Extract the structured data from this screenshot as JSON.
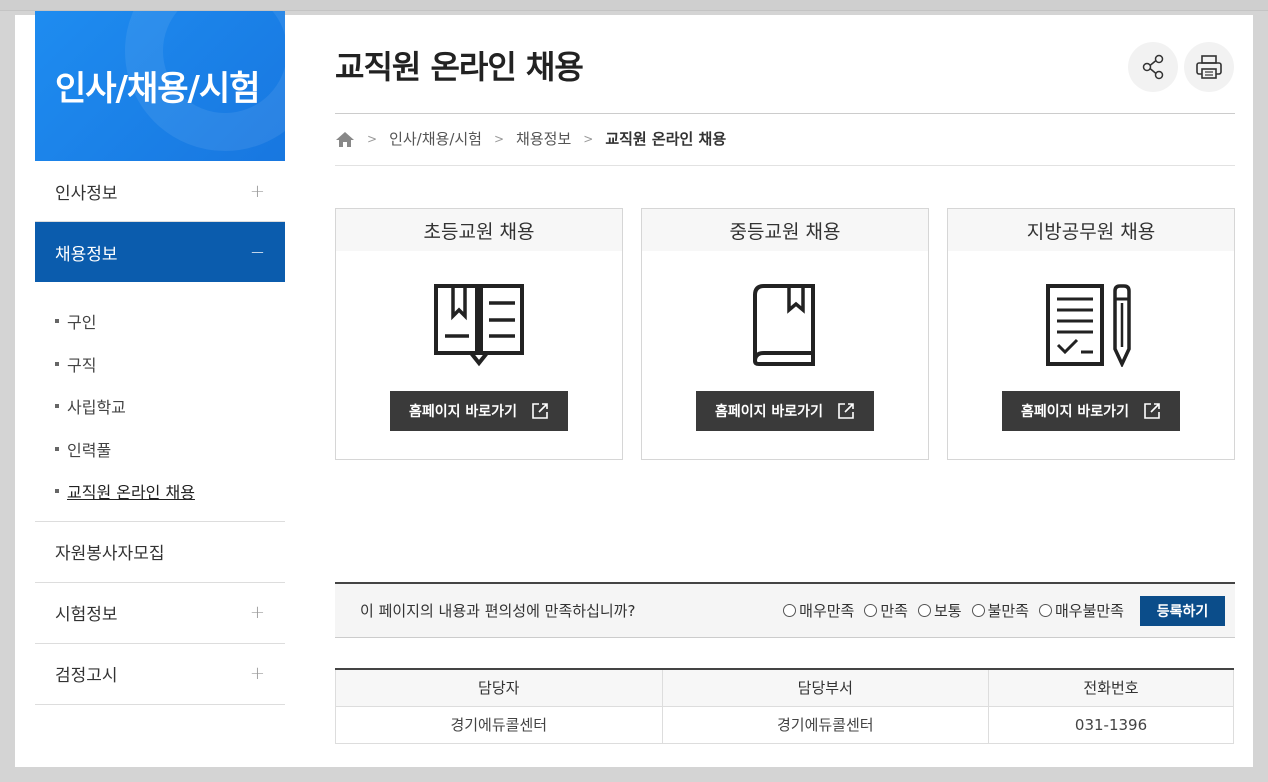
{
  "sidebar": {
    "title": "인사/채용/시험",
    "items": [
      {
        "label": "인사정보",
        "toggle": "+"
      },
      {
        "label": "채용정보",
        "toggle": "−"
      },
      {
        "label": "자원봉사자모집"
      },
      {
        "label": "시험정보",
        "toggle": "+"
      },
      {
        "label": "검정고시",
        "toggle": "+"
      }
    ],
    "sub_items": [
      "구인",
      "구직",
      "사립학교",
      "인력풀",
      "교직원 온라인 채용"
    ]
  },
  "header": {
    "title": "교직원 온라인 채용",
    "share_icon": "share-icon",
    "print_icon": "printer-icon"
  },
  "breadcrumb": {
    "home_icon": "home-icon",
    "items": [
      "인사/채용/시험",
      "채용정보",
      "교직원 온라인 채용"
    ]
  },
  "cards": [
    {
      "title": "초등교원 채용",
      "icon": "open-book-icon",
      "button": "홈페이지 바로가기"
    },
    {
      "title": "중등교원 채용",
      "icon": "closed-book-icon",
      "button": "홈페이지 바로가기"
    },
    {
      "title": "지방공무원 채용",
      "icon": "document-pencil-icon",
      "button": "홈페이지 바로가기"
    }
  ],
  "survey": {
    "question": "이 페이지의 내용과 편의성에 만족하십니까?",
    "options": [
      "매우만족",
      "만족",
      "보통",
      "불만족",
      "매우불만족"
    ],
    "submit": "등록하기"
  },
  "contact": {
    "headers": [
      "담당자",
      "담당부서",
      "전화번호"
    ],
    "row": [
      "경기에듀콜센터",
      "경기에듀콜센터",
      "031-1396"
    ]
  },
  "colors": {
    "sidebar_header": "#1e8cf0",
    "active_menu": "#0b5cad",
    "submit": "#0b4d8a",
    "button_dark": "#3a3a3a"
  }
}
